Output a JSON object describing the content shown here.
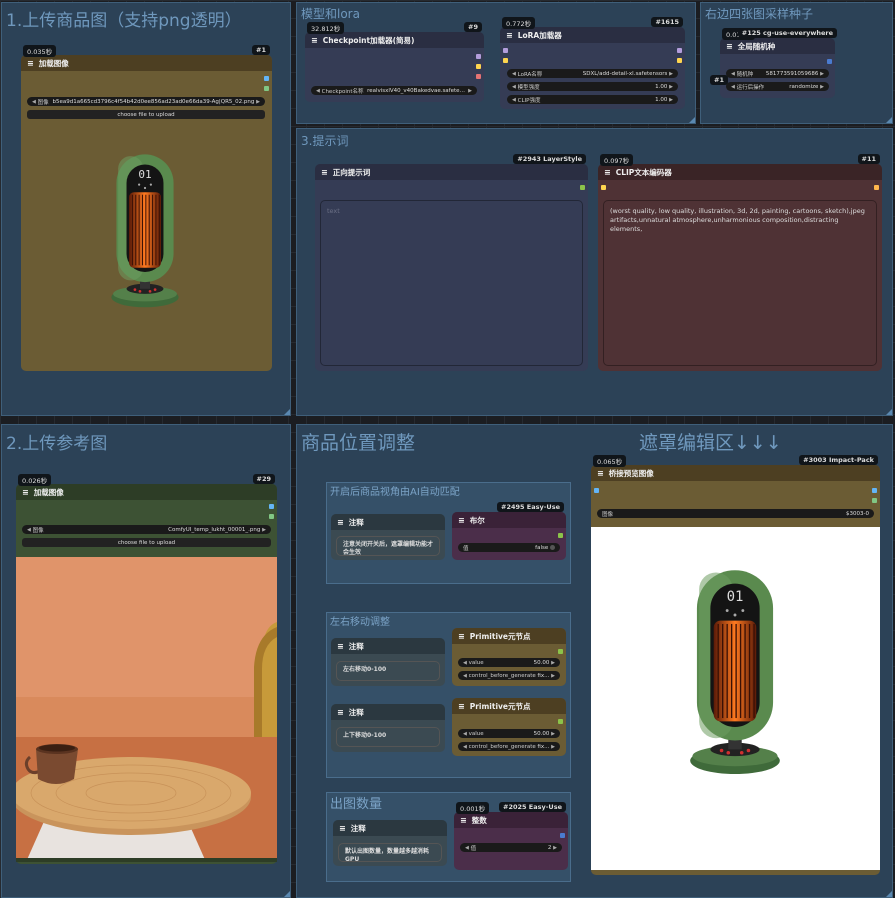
{
  "groups": {
    "g1": "1.上传商品图（支持png透明）",
    "g_model": "模型和lora",
    "g_seed": "右边四张图采样种子",
    "g_prompt": "3.提示词",
    "g2": "2.上传参考图",
    "g_pos": "商品位置调整",
    "g_mask": "遮罩编辑区↓↓↓",
    "sub_ai": "开启后商品视角由AI自动匹配",
    "sub_lr": "左右移动调整",
    "sub_count": "出图数量"
  },
  "load_image_1": {
    "time": "0.035秒",
    "id": "#1",
    "title": "加载图像",
    "widget_label": "图像",
    "widget_value": "b5ea9d1a665cd3796c4f54b42d0ee856ad23ad0e66da39-Ag|QR5_02.png",
    "upload": "choose file to upload"
  },
  "checkpoint": {
    "time": "32.812秒",
    "id": "#9",
    "title": "Checkpoint加载器(简易)",
    "widget_label": "Checkpoint名称",
    "widget_value": "realvisxlV40_v40Bakedvae.safetens..."
  },
  "lora": {
    "time": "0.772秒",
    "id": "#1615",
    "title": "LoRA加载器",
    "widgets": [
      {
        "label": "LoRA名称",
        "value": "SDXL/add-detail-xl.safetensors"
      },
      {
        "label": "模型强度",
        "value": "1.00"
      },
      {
        "label": "CLIP强度",
        "value": "1.00"
      }
    ]
  },
  "seed": {
    "time": "0.019秒",
    "id": "#125 cg-use-everywhere",
    "title": "全局随机种",
    "side_badge": "#1",
    "widgets": [
      {
        "label": "随机种",
        "value": "581773591059686"
      },
      {
        "label": "运行后操作",
        "value": "randomize"
      }
    ]
  },
  "pos_prompt": {
    "id": "#2943 LayerStyle",
    "title": "正向提示词",
    "placeholder": "text"
  },
  "clip_encode": {
    "time": "0.097秒",
    "id": "#11",
    "title": "CLIP文本编码器",
    "text": "(worst quality, low quality, illustration, 3d, 2d, painting, cartoons, sketch),jpeg artifacts,unnatural atmosphere,unharmonious composition,distracting elements,"
  },
  "load_image_2": {
    "time": "0.026秒",
    "id": "#29",
    "title": "加载图像",
    "widget_label": "图像",
    "widget_value": "ComfyUI_temp_lukht_00001_.png",
    "upload": "choose file to upload"
  },
  "note_ai": {
    "title": "注释",
    "text": "注意关闭开关后，遮罩编辑功能才会生效"
  },
  "bool_node": {
    "id": "#2495 Easy-Use",
    "title": "布尔",
    "widget_label": "值",
    "widget_value": "false"
  },
  "note_lr": {
    "title": "注释",
    "text": "左右移动0-100"
  },
  "prim_1": {
    "title": "Primitive元节点",
    "widgets": [
      {
        "label": "value",
        "value": "50.00"
      },
      {
        "label": "control_before_generate",
        "value": "fix..."
      }
    ]
  },
  "note_ud": {
    "title": "注释",
    "text": "上下移动0-100"
  },
  "prim_2": {
    "title": "Primitive元节点",
    "widgets": [
      {
        "label": "value",
        "value": "50.00"
      },
      {
        "label": "control_before_generate",
        "value": "fix..."
      }
    ]
  },
  "note_count": {
    "title": "注释",
    "text": "默认出图数量，数量越多越消耗GPU"
  },
  "int_node": {
    "time": "0.001秒",
    "id": "#2025 Easy-Use",
    "title": "整数",
    "widget_label": "值",
    "widget_value": "2"
  },
  "preview": {
    "time": "0.065秒",
    "id": "#3003 Impact-Pack",
    "title": "桥接预览图像",
    "widget_label": "图像",
    "widget_value": "$3003-0"
  },
  "heater_display": "01",
  "colors": {
    "group": "#2c4257",
    "node_body_dark": "#353c55",
    "node_body_olive": "#6b5c34",
    "node_body_maroon": "#4f3235"
  }
}
